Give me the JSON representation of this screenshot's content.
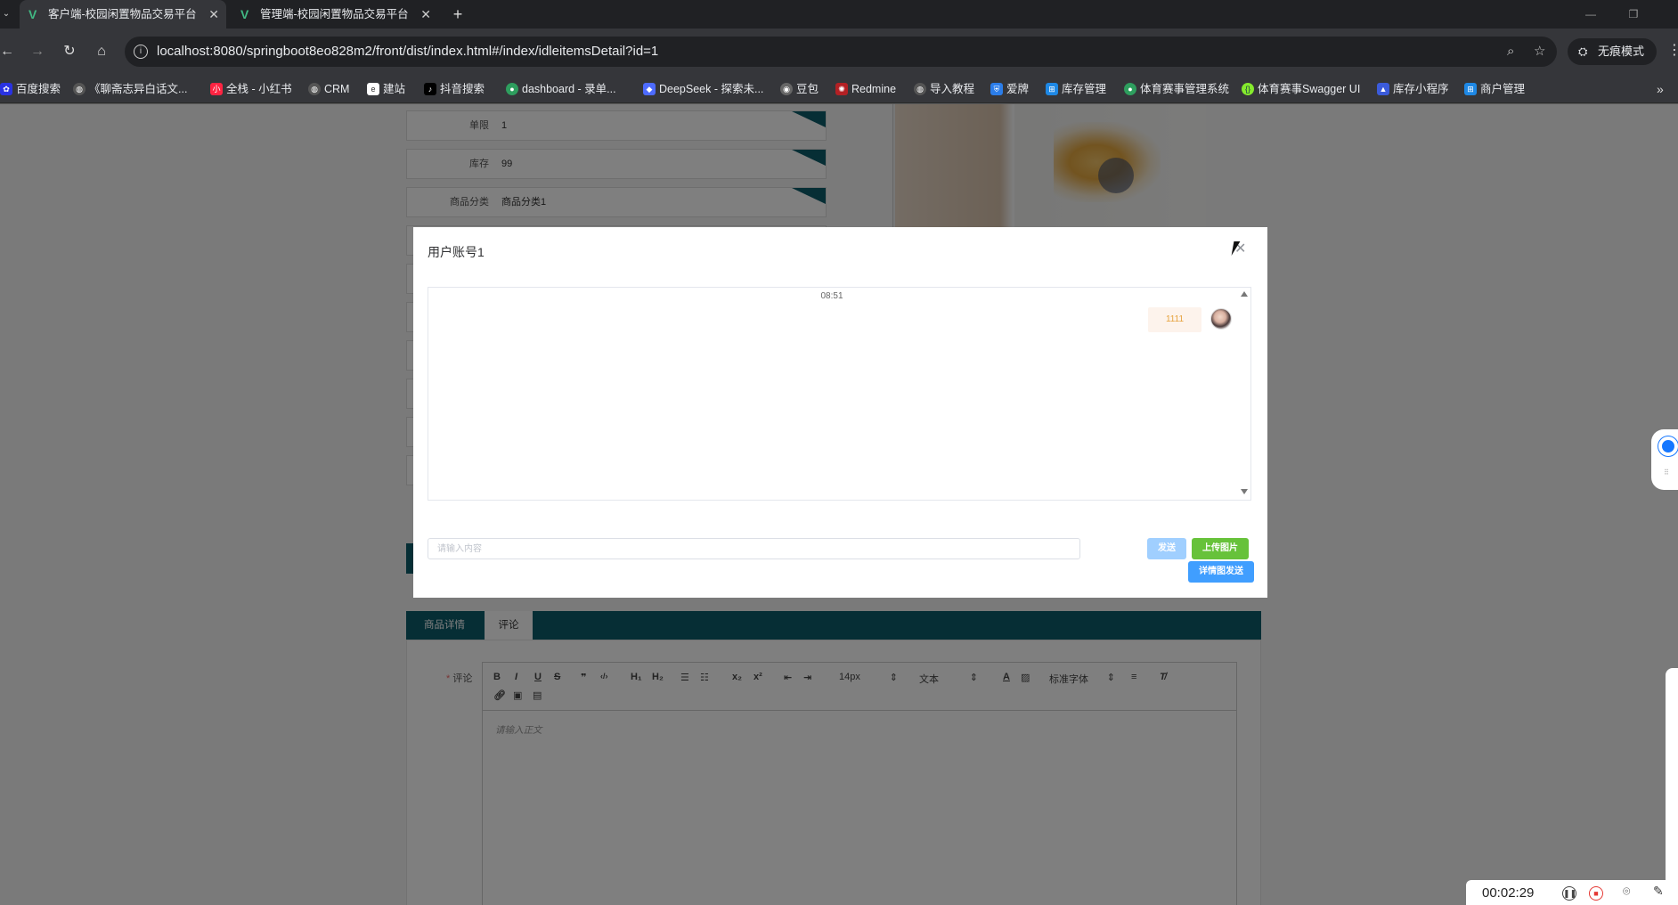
{
  "browser": {
    "tabs": [
      {
        "title": "客户端-校园闲置物品交易平台"
      },
      {
        "title": "管理端-校园闲置物品交易平台"
      }
    ],
    "url": "localhost:8080/springboot8eo828m2/front/dist/index.html#/index/idleitemsDetail?id=1",
    "incognito_label": "无痕模式",
    "bookmarks": [
      {
        "label": "百度搜索",
        "icon": "paw-icon"
      },
      {
        "label": "《聊斋志异白话文...",
        "icon": "globe-icon"
      },
      {
        "label": "全栈 - 小红书",
        "icon": "xiaohongshu-icon"
      },
      {
        "label": "CRM",
        "icon": "globe-icon"
      },
      {
        "label": "建站",
        "icon": "site-icon"
      },
      {
        "label": "抖音搜索",
        "icon": "tiktok-icon"
      },
      {
        "label": "dashboard - 录单...",
        "icon": "dashboard-icon"
      },
      {
        "label": "DeepSeek - 探索未...",
        "icon": "deepseek-icon"
      },
      {
        "label": "豆包",
        "icon": "doubao-icon"
      },
      {
        "label": "Redmine",
        "icon": "redmine-icon"
      },
      {
        "label": "导入教程",
        "icon": "globe-icon"
      },
      {
        "label": "爱牌",
        "icon": "shield-icon"
      },
      {
        "label": "库存管理",
        "icon": "app-icon"
      },
      {
        "label": "体育赛事管理系统",
        "icon": "leaf-icon"
      },
      {
        "label": "体育赛事Swagger UI",
        "icon": "swagger-icon"
      },
      {
        "label": "库存小程序",
        "icon": "triangle-icon"
      },
      {
        "label": "商户管理",
        "icon": "app-icon"
      }
    ]
  },
  "product": {
    "rows": [
      {
        "label": "单限",
        "value": "1"
      },
      {
        "label": "库存",
        "value": "99"
      },
      {
        "label": "商品分类",
        "value": "商品分类1"
      }
    ]
  },
  "detail_tabs": [
    {
      "label": "商品详情",
      "active": false
    },
    {
      "label": "评论",
      "active": true
    }
  ],
  "comment": {
    "label": "评论",
    "required_mark": "*",
    "editor_placeholder": "请输入正文",
    "toolbar": {
      "buttons_row1": [
        "B",
        "I",
        "U",
        "S",
        "❞",
        "‹/›",
        "H₁",
        "H₂",
        "☰",
        "☷",
        "x₂",
        "x²",
        "⇤",
        "⇥"
      ],
      "font_size": "14px",
      "block_type": "文本",
      "font_family": "标准字体"
    }
  },
  "chat": {
    "title": "用户账号1",
    "time": "08:51",
    "messages": [
      {
        "text": "1111",
        "side": "right"
      }
    ],
    "input_placeholder": "请输入内容",
    "send_label": "发送",
    "upload_label": "上传图片",
    "detail_send_label": "详情图发送"
  },
  "recorder": {
    "elapsed": "00:02:29"
  },
  "colors": {
    "theme_teal": "#0d5c6a",
    "send_disabled": "#a0cfff",
    "upload_green": "#67c23a",
    "primary_blue": "#409eff"
  }
}
